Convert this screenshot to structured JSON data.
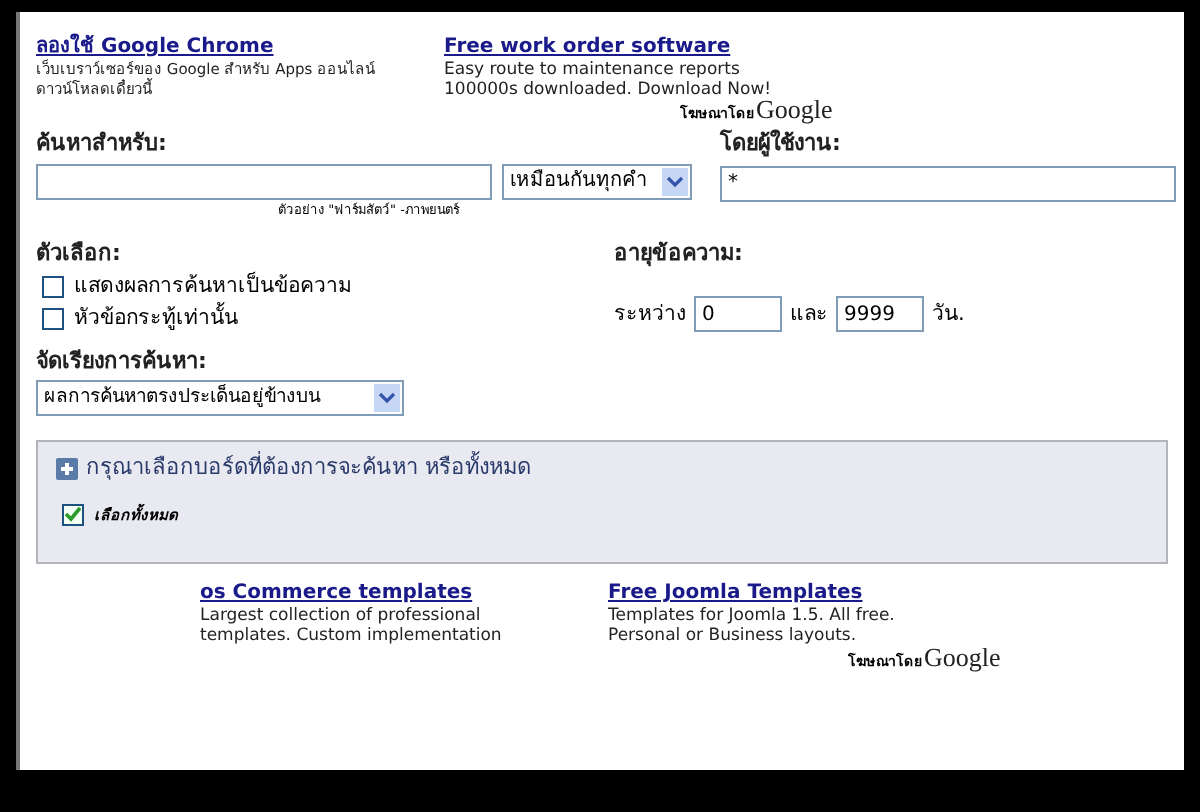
{
  "top_ads": [
    {
      "title": "ลองใช้ Google Chrome",
      "lines": [
        "เว็บเบราว์เซอร์ของ Google สำหรับ Apps ออนไลน์",
        "ดาวน์โหลดเดี๋ยวนี้"
      ]
    },
    {
      "title": "Free work order software",
      "lines": [
        "Easy route to maintenance reports",
        "100000s downloaded. Download Now!"
      ]
    }
  ],
  "top_ads_by": {
    "prefix": "โฆษณาโดย",
    "brand": "Google"
  },
  "search": {
    "label": "ค้นหาสำหรับ:",
    "match": "เหมือนกันทุกคำ",
    "example": "ตัวอย่าง \"ฟาร์มสัตว์\" -ภาพยนตร์"
  },
  "user": {
    "label": "โดยผู้ใช้งาน:",
    "value": "*"
  },
  "options": {
    "label": "ตัวเลือก:",
    "items": [
      {
        "label": "แสดงผลการค้นหาเป็นข้อความ",
        "checked": false
      },
      {
        "label": "หัวข้อกระทู้เท่านั้น",
        "checked": false
      }
    ]
  },
  "age": {
    "label": "อายุข้อความ:",
    "between": "ระหว่าง",
    "from": "0",
    "and": "และ",
    "to": "9999",
    "unit": "วัน."
  },
  "sort": {
    "label": "จัดเรียงการค้นหา:",
    "value": "ผลการค้นหาตรงประเด็นอยู่ข้างบน"
  },
  "boards": {
    "title": "กรุณาเลือกบอร์ดที่ต้องการจะค้นหา หรือทั้งหมด",
    "expanded": false,
    "select_all": {
      "label": "เลือกทั้งหมด",
      "checked": true
    }
  },
  "bottom_ads": [
    {
      "title": "os Commerce templates",
      "lines": [
        "Largest collection of professional",
        "templates. Custom implementation"
      ]
    },
    {
      "title": "Free Joomla Templates",
      "lines": [
        "Templates for Joomla 1.5. All free.",
        "Personal or Business layouts."
      ]
    }
  ],
  "bottom_ads_by": {
    "prefix": "โฆษณาโดย",
    "brand": "Google"
  }
}
